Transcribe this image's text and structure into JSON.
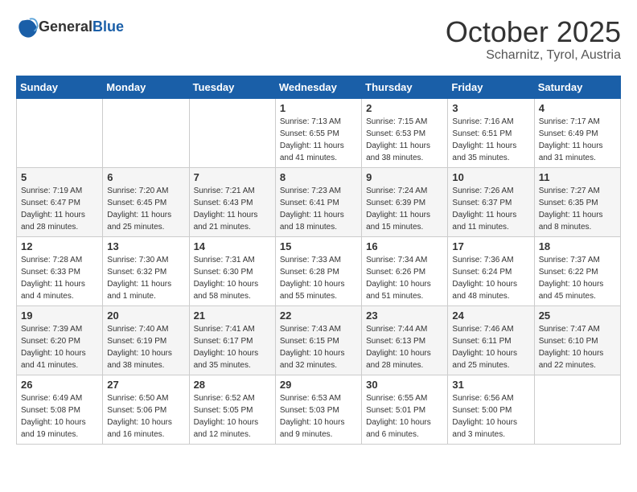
{
  "header": {
    "logo_general": "General",
    "logo_blue": "Blue",
    "month": "October 2025",
    "location": "Scharnitz, Tyrol, Austria"
  },
  "days_of_week": [
    "Sunday",
    "Monday",
    "Tuesday",
    "Wednesday",
    "Thursday",
    "Friday",
    "Saturday"
  ],
  "weeks": [
    [
      {
        "day": "",
        "sunrise": "",
        "sunset": "",
        "daylight": ""
      },
      {
        "day": "",
        "sunrise": "",
        "sunset": "",
        "daylight": ""
      },
      {
        "day": "",
        "sunrise": "",
        "sunset": "",
        "daylight": ""
      },
      {
        "day": "1",
        "sunrise": "Sunrise: 7:13 AM",
        "sunset": "Sunset: 6:55 PM",
        "daylight": "Daylight: 11 hours and 41 minutes."
      },
      {
        "day": "2",
        "sunrise": "Sunrise: 7:15 AM",
        "sunset": "Sunset: 6:53 PM",
        "daylight": "Daylight: 11 hours and 38 minutes."
      },
      {
        "day": "3",
        "sunrise": "Sunrise: 7:16 AM",
        "sunset": "Sunset: 6:51 PM",
        "daylight": "Daylight: 11 hours and 35 minutes."
      },
      {
        "day": "4",
        "sunrise": "Sunrise: 7:17 AM",
        "sunset": "Sunset: 6:49 PM",
        "daylight": "Daylight: 11 hours and 31 minutes."
      }
    ],
    [
      {
        "day": "5",
        "sunrise": "Sunrise: 7:19 AM",
        "sunset": "Sunset: 6:47 PM",
        "daylight": "Daylight: 11 hours and 28 minutes."
      },
      {
        "day": "6",
        "sunrise": "Sunrise: 7:20 AM",
        "sunset": "Sunset: 6:45 PM",
        "daylight": "Daylight: 11 hours and 25 minutes."
      },
      {
        "day": "7",
        "sunrise": "Sunrise: 7:21 AM",
        "sunset": "Sunset: 6:43 PM",
        "daylight": "Daylight: 11 hours and 21 minutes."
      },
      {
        "day": "8",
        "sunrise": "Sunrise: 7:23 AM",
        "sunset": "Sunset: 6:41 PM",
        "daylight": "Daylight: 11 hours and 18 minutes."
      },
      {
        "day": "9",
        "sunrise": "Sunrise: 7:24 AM",
        "sunset": "Sunset: 6:39 PM",
        "daylight": "Daylight: 11 hours and 15 minutes."
      },
      {
        "day": "10",
        "sunrise": "Sunrise: 7:26 AM",
        "sunset": "Sunset: 6:37 PM",
        "daylight": "Daylight: 11 hours and 11 minutes."
      },
      {
        "day": "11",
        "sunrise": "Sunrise: 7:27 AM",
        "sunset": "Sunset: 6:35 PM",
        "daylight": "Daylight: 11 hours and 8 minutes."
      }
    ],
    [
      {
        "day": "12",
        "sunrise": "Sunrise: 7:28 AM",
        "sunset": "Sunset: 6:33 PM",
        "daylight": "Daylight: 11 hours and 4 minutes."
      },
      {
        "day": "13",
        "sunrise": "Sunrise: 7:30 AM",
        "sunset": "Sunset: 6:32 PM",
        "daylight": "Daylight: 11 hours and 1 minute."
      },
      {
        "day": "14",
        "sunrise": "Sunrise: 7:31 AM",
        "sunset": "Sunset: 6:30 PM",
        "daylight": "Daylight: 10 hours and 58 minutes."
      },
      {
        "day": "15",
        "sunrise": "Sunrise: 7:33 AM",
        "sunset": "Sunset: 6:28 PM",
        "daylight": "Daylight: 10 hours and 55 minutes."
      },
      {
        "day": "16",
        "sunrise": "Sunrise: 7:34 AM",
        "sunset": "Sunset: 6:26 PM",
        "daylight": "Daylight: 10 hours and 51 minutes."
      },
      {
        "day": "17",
        "sunrise": "Sunrise: 7:36 AM",
        "sunset": "Sunset: 6:24 PM",
        "daylight": "Daylight: 10 hours and 48 minutes."
      },
      {
        "day": "18",
        "sunrise": "Sunrise: 7:37 AM",
        "sunset": "Sunset: 6:22 PM",
        "daylight": "Daylight: 10 hours and 45 minutes."
      }
    ],
    [
      {
        "day": "19",
        "sunrise": "Sunrise: 7:39 AM",
        "sunset": "Sunset: 6:20 PM",
        "daylight": "Daylight: 10 hours and 41 minutes."
      },
      {
        "day": "20",
        "sunrise": "Sunrise: 7:40 AM",
        "sunset": "Sunset: 6:19 PM",
        "daylight": "Daylight: 10 hours and 38 minutes."
      },
      {
        "day": "21",
        "sunrise": "Sunrise: 7:41 AM",
        "sunset": "Sunset: 6:17 PM",
        "daylight": "Daylight: 10 hours and 35 minutes."
      },
      {
        "day": "22",
        "sunrise": "Sunrise: 7:43 AM",
        "sunset": "Sunset: 6:15 PM",
        "daylight": "Daylight: 10 hours and 32 minutes."
      },
      {
        "day": "23",
        "sunrise": "Sunrise: 7:44 AM",
        "sunset": "Sunset: 6:13 PM",
        "daylight": "Daylight: 10 hours and 28 minutes."
      },
      {
        "day": "24",
        "sunrise": "Sunrise: 7:46 AM",
        "sunset": "Sunset: 6:11 PM",
        "daylight": "Daylight: 10 hours and 25 minutes."
      },
      {
        "day": "25",
        "sunrise": "Sunrise: 7:47 AM",
        "sunset": "Sunset: 6:10 PM",
        "daylight": "Daylight: 10 hours and 22 minutes."
      }
    ],
    [
      {
        "day": "26",
        "sunrise": "Sunrise: 6:49 AM",
        "sunset": "Sunset: 5:08 PM",
        "daylight": "Daylight: 10 hours and 19 minutes."
      },
      {
        "day": "27",
        "sunrise": "Sunrise: 6:50 AM",
        "sunset": "Sunset: 5:06 PM",
        "daylight": "Daylight: 10 hours and 16 minutes."
      },
      {
        "day": "28",
        "sunrise": "Sunrise: 6:52 AM",
        "sunset": "Sunset: 5:05 PM",
        "daylight": "Daylight: 10 hours and 12 minutes."
      },
      {
        "day": "29",
        "sunrise": "Sunrise: 6:53 AM",
        "sunset": "Sunset: 5:03 PM",
        "daylight": "Daylight: 10 hours and 9 minutes."
      },
      {
        "day": "30",
        "sunrise": "Sunrise: 6:55 AM",
        "sunset": "Sunset: 5:01 PM",
        "daylight": "Daylight: 10 hours and 6 minutes."
      },
      {
        "day": "31",
        "sunrise": "Sunrise: 6:56 AM",
        "sunset": "Sunset: 5:00 PM",
        "daylight": "Daylight: 10 hours and 3 minutes."
      },
      {
        "day": "",
        "sunrise": "",
        "sunset": "",
        "daylight": ""
      }
    ]
  ]
}
